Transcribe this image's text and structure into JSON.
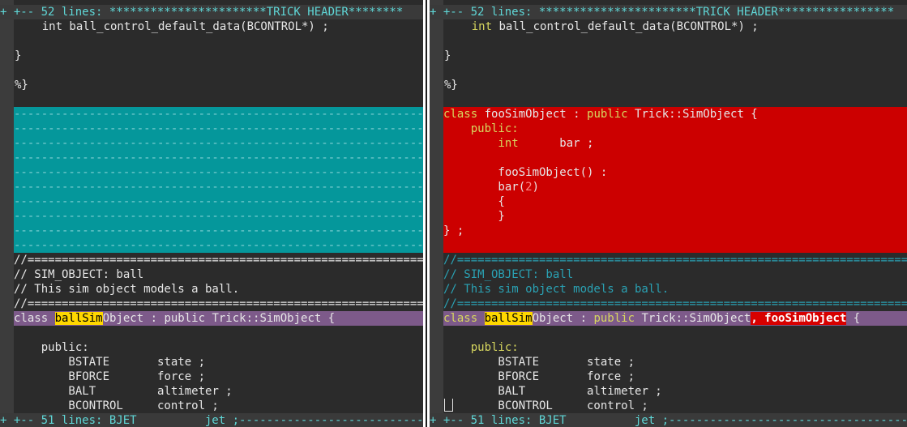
{
  "left": {
    "fold_top": "+ +-- 52 lines: ***********************TRICK HEADER********",
    "l1": "    int ball_control_default_data(BCONTROL*) ;",
    "l2": "",
    "l3": "}",
    "l4": "",
    "l5": "%}",
    "dashes": "--------------------------------------------------------------------",
    "sep1": "//=====================================================================",
    "c1": "// SIM_OBJECT: ball",
    "c2": "// This sim object models a ball.",
    "sep2": "//=====================================================================",
    "class_pre": "class ",
    "class_hl": "ballSim",
    "class_post": "Object : public Trick::SimObject {",
    "public": "    public:",
    "m1_type": "        BSTATE",
    "m1_name": "       state ;",
    "m2_type": "        BFORCE",
    "m2_name": "       force ;",
    "m3_type": "        BALT",
    "m3_name": "         altimeter ;",
    "m4_type": "        BCONTROL",
    "m4_name": "     control ;",
    "fold_bottom": "+ +-- 51 lines: BJET          jet ;-----------------------------------------"
  },
  "right": {
    "fold_top": "+ +-- 52 lines: ***********************TRICK HEADER*****************",
    "l1_kw": "    int",
    "l1_rest": " ball_control_default_data(BCONTROL*) ;",
    "l3": "}",
    "l5": "%}",
    "r1_kw": "class",
    "r1_a": " fooSimObject : ",
    "r1_kw2": "public",
    "r1_b": " Trick::SimObject {",
    "r2": "    public:",
    "r3_type": "        int",
    "r3_rest": "      bar ;",
    "r5": "        fooSimObject() :",
    "r6_a": "        bar(",
    "r6_num": "2",
    "r6_b": ")",
    "r7": "        {",
    "r8": "        }",
    "r9": "} ;",
    "sep1": "//=====================================================================",
    "c1": "// SIM_OBJECT: ball",
    "c2": "// This sim object models a ball.",
    "sep2": "//=====================================================================",
    "class_kw": "class ",
    "class_hl": "ballSim",
    "class_mid": "Object : ",
    "class_pub": "public",
    "class_post": " Trick::SimObject",
    "class_changed": ", fooSimObject",
    "class_end": " {",
    "public": "    public:",
    "m1_type": "        BSTATE",
    "m1_name": "       state ;",
    "m2_type": "        BFORCE",
    "m2_name": "       force ;",
    "m3_type": "        BALT",
    "m3_name": "         altimeter ;",
    "m4_type": "        BCONTROL",
    "m4_name": "     control ;",
    "fold_bottom": "+ +-- 51 lines: BJET          jet ;-----------------------------------------"
  }
}
